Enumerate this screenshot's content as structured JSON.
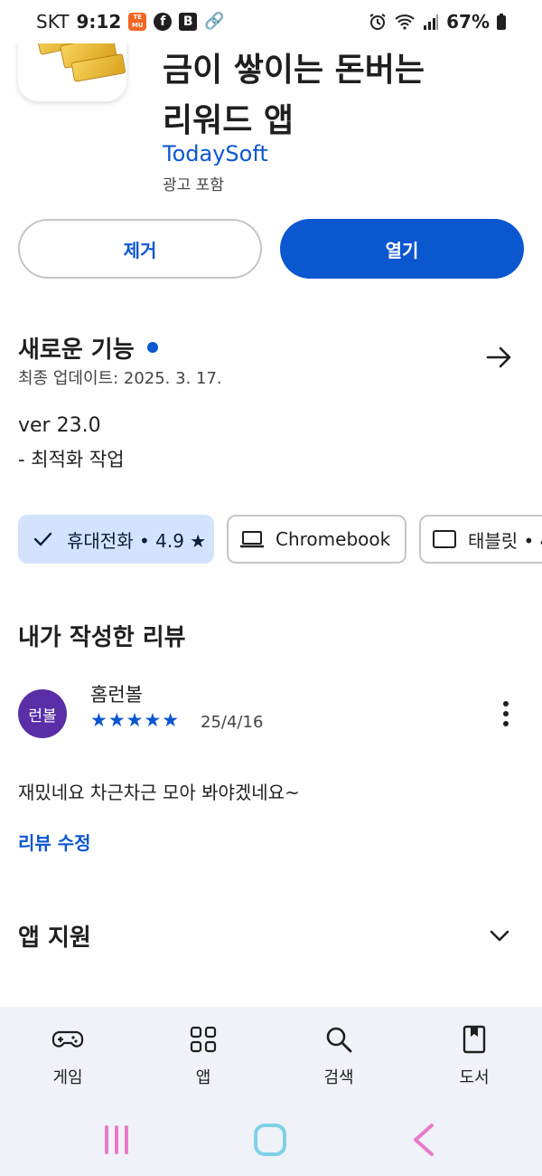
{
  "status": {
    "carrier": "SKT",
    "time": "9:12",
    "battery": "67%"
  },
  "app": {
    "title_line1": "금이 쌓이는 돈버는",
    "title_line2": "리워드 앱",
    "developer": "TodaySoft",
    "ads": "광고 포함"
  },
  "actions": {
    "remove": "제거",
    "open": "열기"
  },
  "whats_new": {
    "title": "새로운 기능",
    "updated": "최종 업데이트: 2025. 3. 17.",
    "version": "ver 23.0",
    "notes": "- 최적화 작업"
  },
  "device_chips": [
    {
      "label": "휴대전화 • 4.9 ★",
      "selected": true
    },
    {
      "label": "Chromebook",
      "selected": false
    },
    {
      "label": "태블릿 • 4",
      "selected": false
    }
  ],
  "my_review": {
    "title": "내가 작성한 리뷰",
    "avatar_text": "런볼",
    "reviewer": "홈런볼",
    "stars": "★★★★★",
    "rating": 5,
    "date": "25/4/16",
    "text": "재밌네요 차근차근 모아 봐야겠네요~",
    "edit": "리뷰 수정"
  },
  "support": {
    "title": "앱 지원"
  },
  "nav": [
    {
      "label": "게임",
      "icon": "gamepad-icon"
    },
    {
      "label": "앱",
      "icon": "apps-grid-icon"
    },
    {
      "label": "검색",
      "icon": "search-icon"
    },
    {
      "label": "도서",
      "icon": "book-icon"
    }
  ],
  "colors": {
    "accent": "#0b57d0",
    "chip_selected": "#d3e3fd",
    "nav_bg": "#eff2f8",
    "avatar": "#5a2ea6"
  }
}
